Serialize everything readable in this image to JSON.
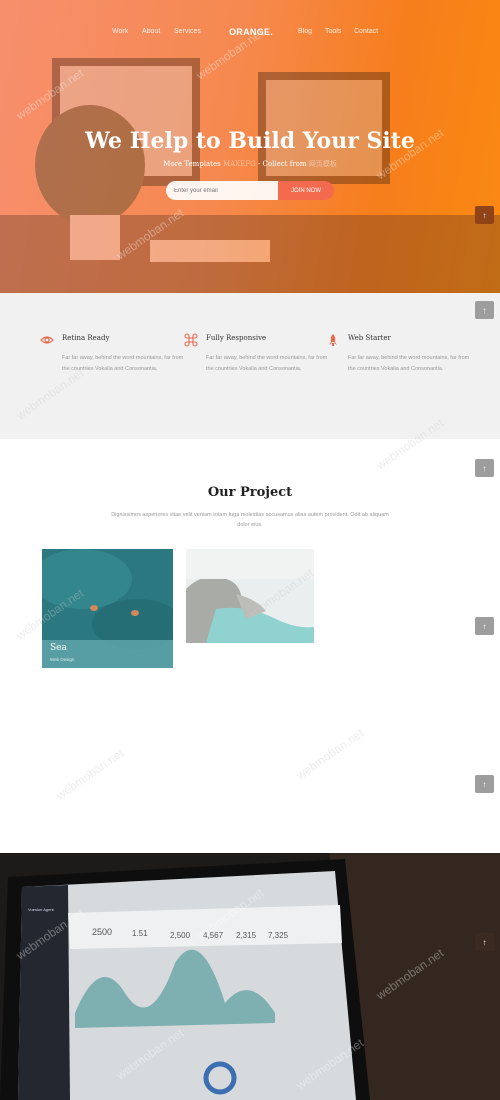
{
  "nav": {
    "links_left": [
      "Work",
      "About",
      "Services"
    ],
    "brand": "ORANGE.",
    "links_right": [
      "Blog",
      "Tools",
      "Contact"
    ]
  },
  "hero": {
    "title": "We Help to Build Your Site",
    "subtitle_start": "More Templates ",
    "subtitle_faint_1": "MAXEFG",
    "subtitle_mid": " - Collect from ",
    "subtitle_faint_2": "网页模板",
    "email_placeholder": "Enter your email",
    "join_label": "JOIN NOW"
  },
  "features": [
    {
      "icon": "eye-icon",
      "title": "Retina Ready",
      "text": "Far far away, behind the word mountains, far from the countries Vokalia and Consonantia."
    },
    {
      "icon": "command-icon",
      "title": "Fully Responsive",
      "text": "Far far away, behind the word mountains, far from the countries Vokalia and Consonantia."
    },
    {
      "icon": "rocket-icon",
      "title": "Web Starter",
      "text": "Far far away, behind the word mountains, far from the countries Vokalia and Consonantia."
    }
  ],
  "project": {
    "title": "Our Project",
    "description": "Dignissimos asperiores vitae velit veniam totam fuga molestias accusamus alias autem provident. Odit ab aliquam dolor eius.",
    "cards": [
      {
        "title": "Sea",
        "category": "Web Design"
      }
    ]
  },
  "laptop": {
    "app_name": "Vuesion Agent",
    "stats": [
      "2500",
      "1.51",
      "2,500",
      "4,567",
      "2,315",
      "7,325"
    ]
  },
  "scroll_top_icon": "arrow-up-icon",
  "watermark": "webmoban.net",
  "colors": {
    "accent": "#f36a4e",
    "hero_orange": "#f77e1c",
    "feature_icon": "#e86a4c"
  }
}
